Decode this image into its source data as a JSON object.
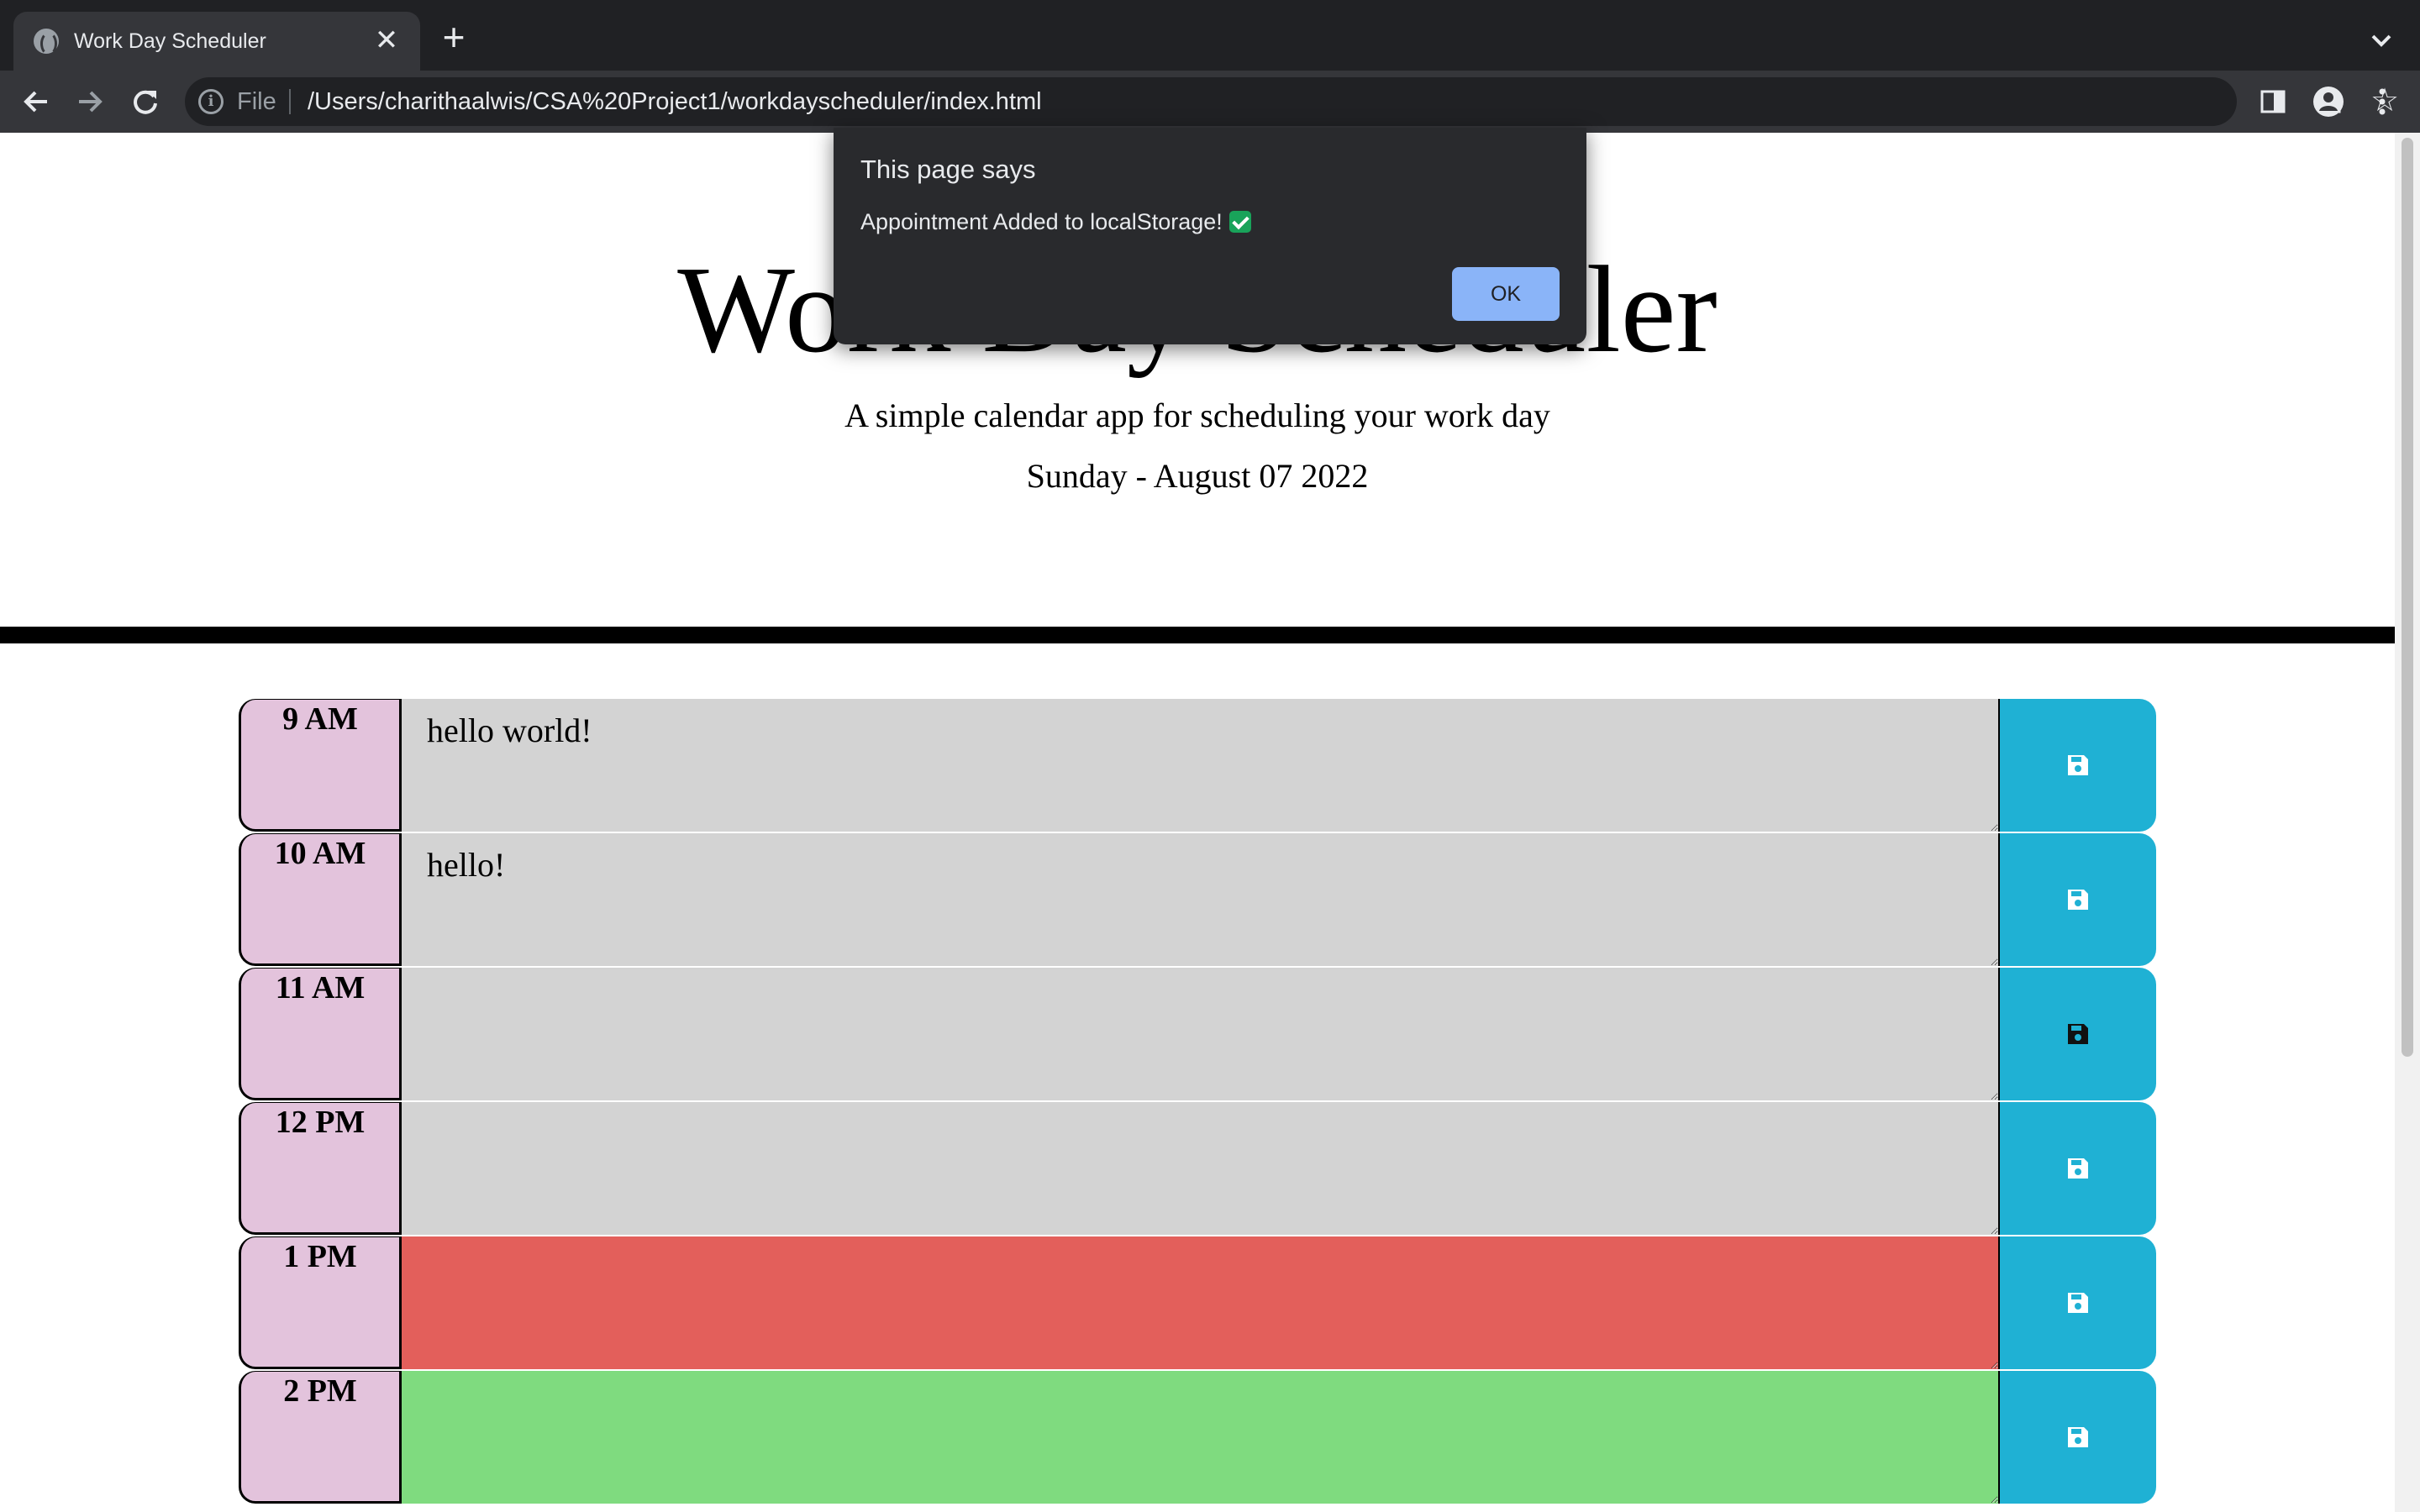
{
  "browser": {
    "tab": {
      "title": "Work Day Scheduler",
      "close_glyph": "✕"
    },
    "new_tab_glyph": "+",
    "omnibox": {
      "scheme_label": "File",
      "url": "/Users/charithaalwis/CSA%20Project1/workdayscheduler/index.html"
    },
    "icons": [
      "globe-icon",
      "close-icon",
      "plus-icon",
      "chevron-down-icon",
      "back-arrow-icon",
      "forward-arrow-icon",
      "reload-icon",
      "info-icon",
      "share-icon",
      "star-icon",
      "side-panel-icon",
      "profile-icon",
      "kebab-menu-icon"
    ]
  },
  "alert": {
    "title": "This page says",
    "message": "Appointment Added to localStorage!",
    "message_emoji": "check-mark-button-icon",
    "ok_label": "OK"
  },
  "page": {
    "title": "Work Day Scheduler",
    "lead": "A simple calendar app for scheduling your work day",
    "current_day": "Sunday - August 07 2022"
  },
  "schedule": {
    "rows": [
      {
        "hour": "9 AM",
        "text": "hello world!",
        "status": "past"
      },
      {
        "hour": "10 AM",
        "text": "hello!",
        "status": "past"
      },
      {
        "hour": "11 AM",
        "text": "",
        "status": "past"
      },
      {
        "hour": "12 PM",
        "text": "",
        "status": "past"
      },
      {
        "hour": "1 PM",
        "text": "",
        "status": "present"
      },
      {
        "hour": "2 PM",
        "text": "",
        "status": "future"
      }
    ],
    "save_icon": "floppy-disk-icon"
  },
  "colors": {
    "hour_bg": "#e3c3dc",
    "past": "#d3d3d3",
    "present": "#e35f5b",
    "future": "#7fdb7f",
    "save_button": "#1fb1d4",
    "dialog_bg": "#292a2d",
    "ok_button": "#8ab4f8"
  }
}
